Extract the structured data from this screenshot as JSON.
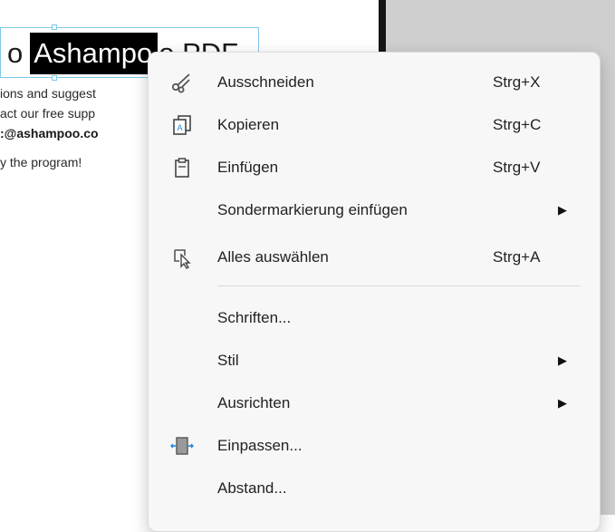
{
  "document": {
    "title_prefix": "o",
    "title_selected": "Ashampo",
    "title_suffix": "o PDF",
    "lines": [
      "ions and suggest",
      "act our free supp",
      ":@ashampoo.co",
      "y the program!"
    ]
  },
  "context_menu": {
    "items": [
      {
        "label": "Ausschneiden",
        "shortcut": "Strg+X",
        "icon": "scissors-icon"
      },
      {
        "label": "Kopieren",
        "shortcut": "Strg+C",
        "icon": "copy-icon"
      },
      {
        "label": "Einfügen",
        "shortcut": "Strg+V",
        "icon": "paste-icon"
      },
      {
        "label": "Sondermarkierung einfügen",
        "shortcut": "",
        "submenu_arrow": "▶"
      },
      {
        "label": "Alles auswählen",
        "shortcut": "Strg+A",
        "icon": "select-all-icon"
      },
      {
        "label": "Schriften...",
        "shortcut": ""
      },
      {
        "label": "Stil",
        "shortcut": "",
        "submenu_arrow": "▶"
      },
      {
        "label": "Ausrichten",
        "shortcut": "",
        "submenu_arrow": "▶"
      },
      {
        "label": "Einpassen...",
        "shortcut": "",
        "icon": "fit-frame-icon"
      },
      {
        "label": "Abstand...",
        "shortcut": ""
      }
    ]
  },
  "colors": {
    "accent": "#1e88e5",
    "selection_frame": "#7fc7e8",
    "menu_background": "#f7f7f7"
  }
}
